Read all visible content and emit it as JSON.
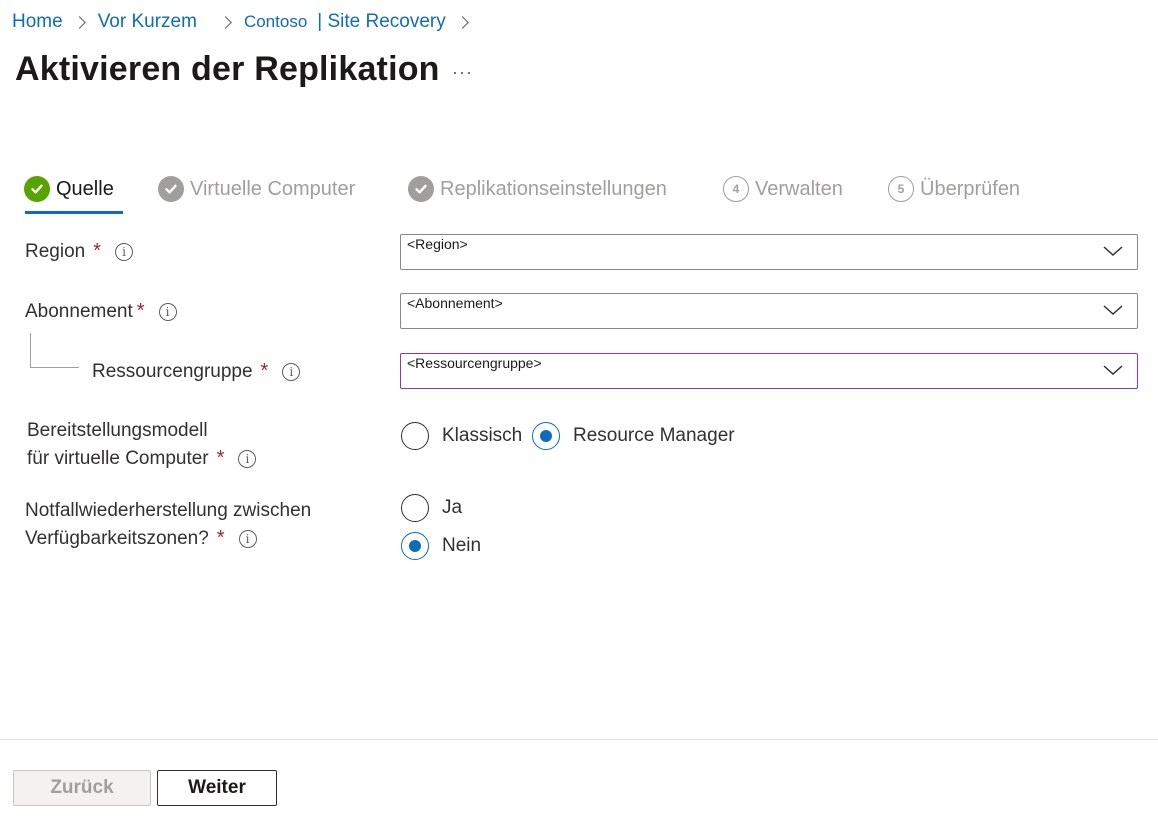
{
  "breadcrumb": {
    "items": [
      "Home",
      "Vor Kurzem",
      "Contoso",
      "| Site Recovery"
    ]
  },
  "header": {
    "title": "Aktivieren der Replikation",
    "more_label": "···"
  },
  "wizard": {
    "steps": [
      {
        "label": "Quelle",
        "state": "active",
        "marker": "check"
      },
      {
        "label": "Virtuelle Computer",
        "state": "completed",
        "marker": "check"
      },
      {
        "label": "Replikationseinstellungen",
        "state": "completed",
        "marker": "check"
      },
      {
        "label": "Verwalten",
        "state": "pending",
        "marker": "4"
      },
      {
        "label": "Überprüfen",
        "state": "pending",
        "marker": "5"
      }
    ]
  },
  "form": {
    "region": {
      "label": "Region",
      "required": "*",
      "value": "<Region>"
    },
    "subscription": {
      "label": "Abonnement",
      "required": "*",
      "value": "<Abonnement>"
    },
    "resource_group": {
      "label": "Ressourcengruppe",
      "required": "*",
      "value": "<Ressourcengruppe>"
    },
    "deployment_model": {
      "label_line1": "Bereitstellungsmodell",
      "label_line2": "für virtuelle Computer",
      "required": "*",
      "options": [
        "Klassisch",
        "Resource Manager"
      ],
      "selected": "Resource Manager"
    },
    "zone_dr": {
      "label_line1": "Notfallwiederherstellung zwischen",
      "label_line2": "Verfügbarkeitszonen?",
      "required": "*",
      "options": [
        "Ja",
        "Nein"
      ],
      "selected": "Nein"
    },
    "info_glyph": "i"
  },
  "footer": {
    "back_label": "Zurück",
    "next_label": "Weiter"
  },
  "colors": {
    "link": "#0f6cbd",
    "active_check": "#57a300",
    "required": "#a4262c",
    "focus_border": "#8a3b9c"
  }
}
